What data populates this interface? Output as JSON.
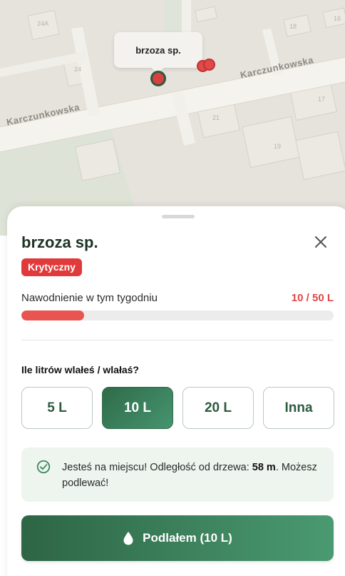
{
  "map": {
    "street_name_top": "Karczunkowska",
    "street_name_left": "Karczunkowska",
    "house_numbers": [
      "24A",
      "24",
      "18",
      "16",
      "21",
      "17",
      "19"
    ],
    "selected_tree_tooltip": "brzoza sp."
  },
  "sheet": {
    "tree_name": "brzoza sp.",
    "status_badge": "Krytyczny",
    "watering_label": "Nawodnienie w tym tygodniu",
    "watering_value": "10 / 50 L",
    "watering_progress": 0.2,
    "question": "Ile litrów wlałeś / wlałaś?",
    "options": [
      {
        "label": "5 L",
        "selected": false
      },
      {
        "label": "10 L",
        "selected": true
      },
      {
        "label": "20 L",
        "selected": false
      },
      {
        "label": "Inna",
        "selected": false
      }
    ],
    "info": {
      "text_before": "Jesteś na miejscu! Odległość od drzewa: ",
      "distance": "58 m",
      "text_after": ". Możesz podlewać!"
    },
    "cta_label": "Podlałem (10 L)"
  },
  "colors": {
    "accent_green": "#2f6b48",
    "critical_red": "#e03a3a",
    "progress_red": "#e85450",
    "info_bg": "#edf5ee"
  },
  "icons": [
    "close-icon",
    "check-circle-icon",
    "water-drop-icon",
    "map-pin-icon"
  ]
}
